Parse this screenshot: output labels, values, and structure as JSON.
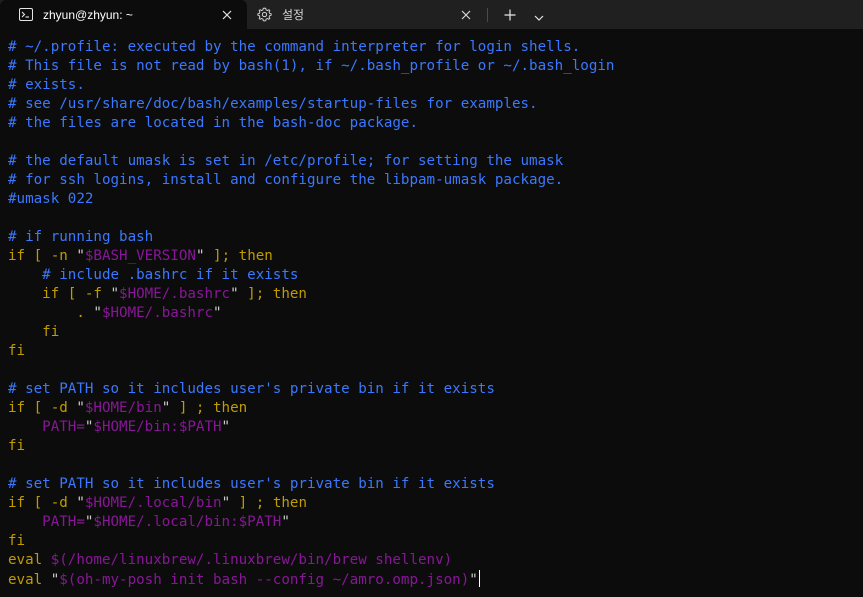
{
  "tabs": [
    {
      "label": "zhyun@zhyun: ~",
      "icon": "terminal-icon",
      "close": "close-icon"
    },
    {
      "label": "설정",
      "icon": "gear-icon",
      "close": "close-icon"
    }
  ],
  "tabbar": {
    "new_tab_icon": "plus-icon",
    "dropdown_icon": "chevron-down-icon"
  },
  "colors": {
    "comment": "#3b78ff",
    "keyword": "#c19c00",
    "string": "#881798",
    "plain": "#cccccc",
    "background": "#0c0c0c",
    "tabbar": "#202020"
  },
  "lines": [
    [
      {
        "t": "# ~/.profile: executed by the command interpreter for login shells.",
        "c": "comment"
      }
    ],
    [
      {
        "t": "# This file is not read by bash(1), if ~/.bash_profile or ~/.bash_login",
        "c": "comment"
      }
    ],
    [
      {
        "t": "# exists.",
        "c": "comment"
      }
    ],
    [
      {
        "t": "# see /usr/share/doc/bash/examples/startup-files for examples.",
        "c": "comment"
      }
    ],
    [
      {
        "t": "# the files are located in the bash-doc package.",
        "c": "comment"
      }
    ],
    [],
    [
      {
        "t": "# the default umask is set in /etc/profile; for setting the umask",
        "c": "comment"
      }
    ],
    [
      {
        "t": "# for ssh logins, install and configure the libpam-umask package.",
        "c": "comment"
      }
    ],
    [
      {
        "t": "#umask 022",
        "c": "comment"
      }
    ],
    [],
    [
      {
        "t": "# if running bash",
        "c": "comment"
      }
    ],
    [
      {
        "t": "if [ -n ",
        "c": "keyword"
      },
      {
        "t": "\"",
        "c": "plain"
      },
      {
        "t": "$BASH_VERSION",
        "c": "string"
      },
      {
        "t": "\"",
        "c": "plain"
      },
      {
        "t": " ]; then",
        "c": "keyword"
      }
    ],
    [
      {
        "t": "    ",
        "c": "plain"
      },
      {
        "t": "# include .bashrc if it exists",
        "c": "comment"
      }
    ],
    [
      {
        "t": "    if [ -f ",
        "c": "keyword"
      },
      {
        "t": "\"",
        "c": "plain"
      },
      {
        "t": "$HOME/.bashrc",
        "c": "string"
      },
      {
        "t": "\"",
        "c": "plain"
      },
      {
        "t": " ]; then",
        "c": "keyword"
      }
    ],
    [
      {
        "t": "        . ",
        "c": "keyword"
      },
      {
        "t": "\"",
        "c": "plain"
      },
      {
        "t": "$HOME/.bashrc",
        "c": "string"
      },
      {
        "t": "\"",
        "c": "plain"
      }
    ],
    [
      {
        "t": "    fi",
        "c": "keyword"
      }
    ],
    [
      {
        "t": "fi",
        "c": "keyword"
      }
    ],
    [],
    [
      {
        "t": "# set PATH so it includes user's private bin if it exists",
        "c": "comment"
      }
    ],
    [
      {
        "t": "if [ -d ",
        "c": "keyword"
      },
      {
        "t": "\"",
        "c": "plain"
      },
      {
        "t": "$HOME/bin",
        "c": "string"
      },
      {
        "t": "\"",
        "c": "plain"
      },
      {
        "t": " ] ; then",
        "c": "keyword"
      }
    ],
    [
      {
        "t": "    PATH=",
        "c": "string"
      },
      {
        "t": "\"",
        "c": "plain"
      },
      {
        "t": "$HOME/bin:$PATH",
        "c": "string"
      },
      {
        "t": "\"",
        "c": "plain"
      }
    ],
    [
      {
        "t": "fi",
        "c": "keyword"
      }
    ],
    [],
    [
      {
        "t": "# set PATH so it includes user's private bin if it exists",
        "c": "comment"
      }
    ],
    [
      {
        "t": "if [ -d ",
        "c": "keyword"
      },
      {
        "t": "\"",
        "c": "plain"
      },
      {
        "t": "$HOME/.local/bin",
        "c": "string"
      },
      {
        "t": "\"",
        "c": "plain"
      },
      {
        "t": " ] ; then",
        "c": "keyword"
      }
    ],
    [
      {
        "t": "    PATH=",
        "c": "string"
      },
      {
        "t": "\"",
        "c": "plain"
      },
      {
        "t": "$HOME/.local/bin:$PATH",
        "c": "string"
      },
      {
        "t": "\"",
        "c": "plain"
      }
    ],
    [
      {
        "t": "fi",
        "c": "keyword"
      }
    ],
    [
      {
        "t": "eval ",
        "c": "keyword"
      },
      {
        "t": "$(/home/linuxbrew/.linuxbrew/bin/brew shellenv)",
        "c": "string"
      }
    ],
    [
      {
        "t": "eval ",
        "c": "keyword"
      },
      {
        "t": "\"",
        "c": "plain"
      },
      {
        "t": "$(oh-my-posh init bash --config ~/amro.omp.json)",
        "c": "string"
      },
      {
        "t": "\"",
        "c": "plain"
      }
    ]
  ]
}
